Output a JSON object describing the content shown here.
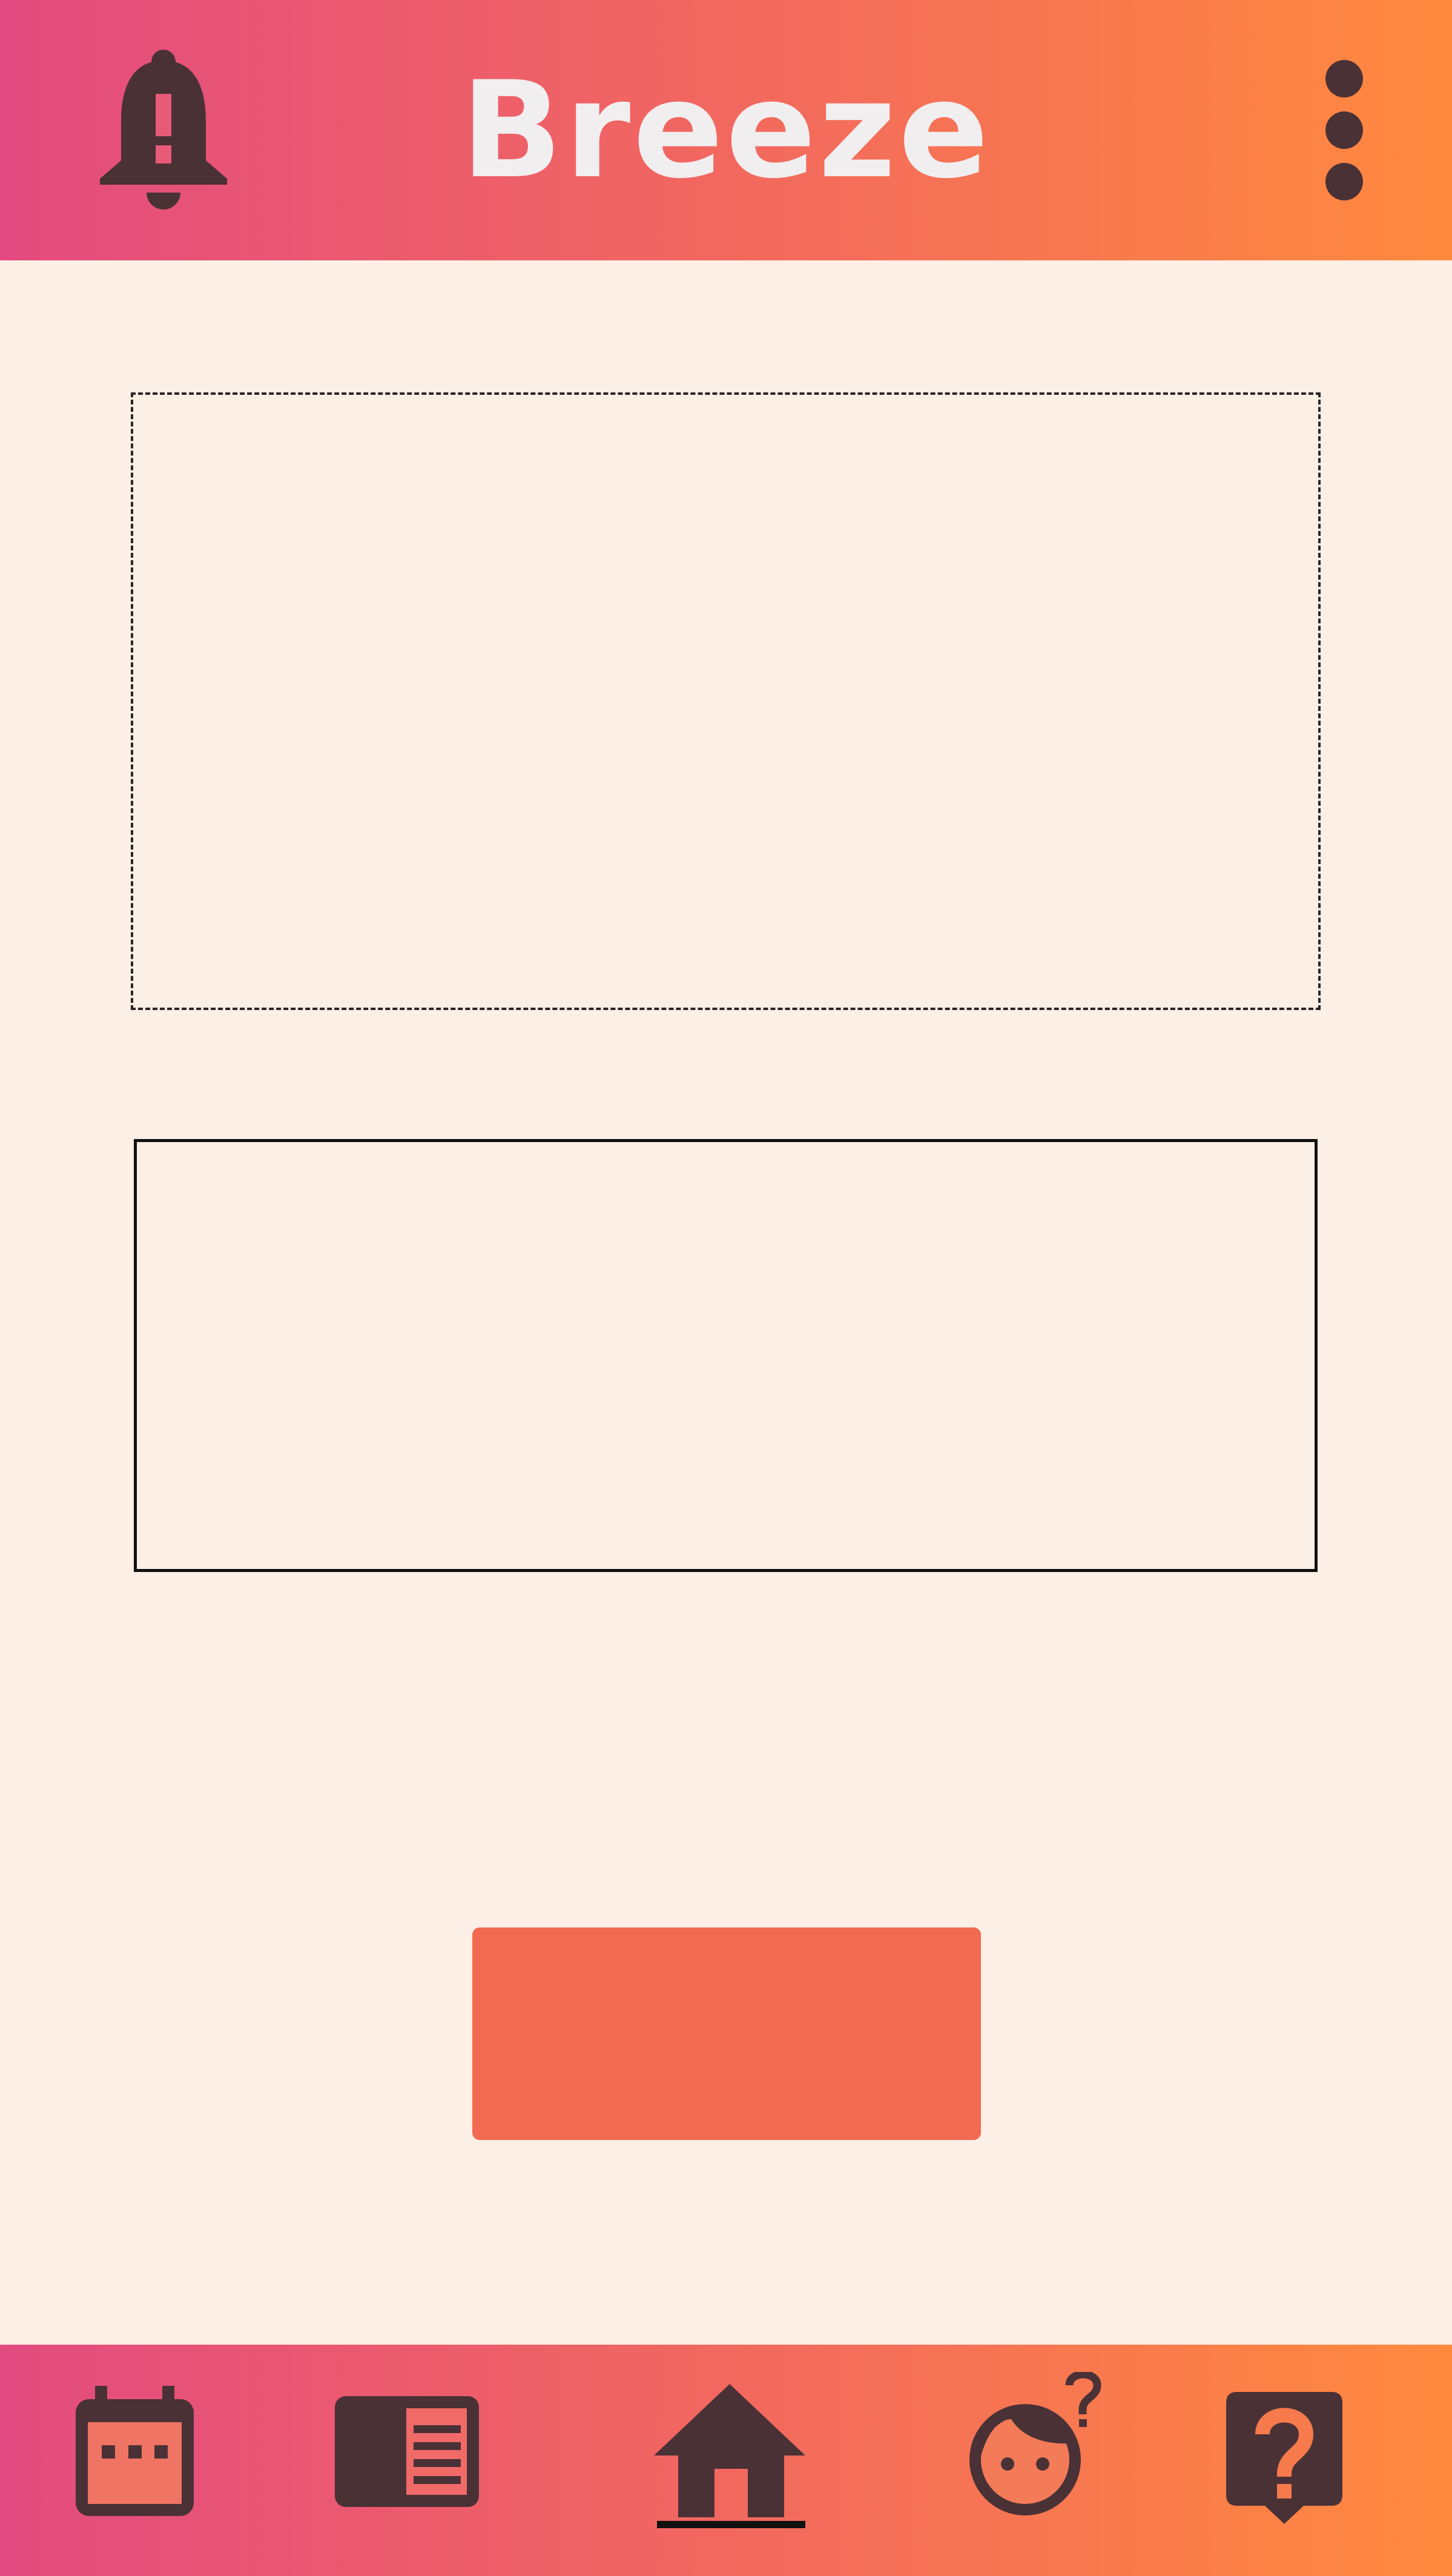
{
  "app": {
    "title": "Breeze"
  },
  "header": {
    "left_icon": "notification-alert-icon",
    "right_icon": "more-vert-icon"
  },
  "main": {
    "primary_button_label": ""
  },
  "bottom_nav": {
    "items": [
      {
        "id": "calendar",
        "icon": "calendar-icon"
      },
      {
        "id": "articles",
        "icon": "article-icon"
      },
      {
        "id": "home",
        "icon": "home-icon",
        "active": true
      },
      {
        "id": "profile",
        "icon": "child-question-icon"
      },
      {
        "id": "help",
        "icon": "help-chat-icon"
      }
    ]
  },
  "colors": {
    "gradient_start": "#e34b80",
    "gradient_mid": "#f2685f",
    "gradient_end": "#ff8a3e",
    "background": "#fcefe5",
    "icon": "#4a3136",
    "button": "#f26a51",
    "title_text": "#f1eef0"
  }
}
